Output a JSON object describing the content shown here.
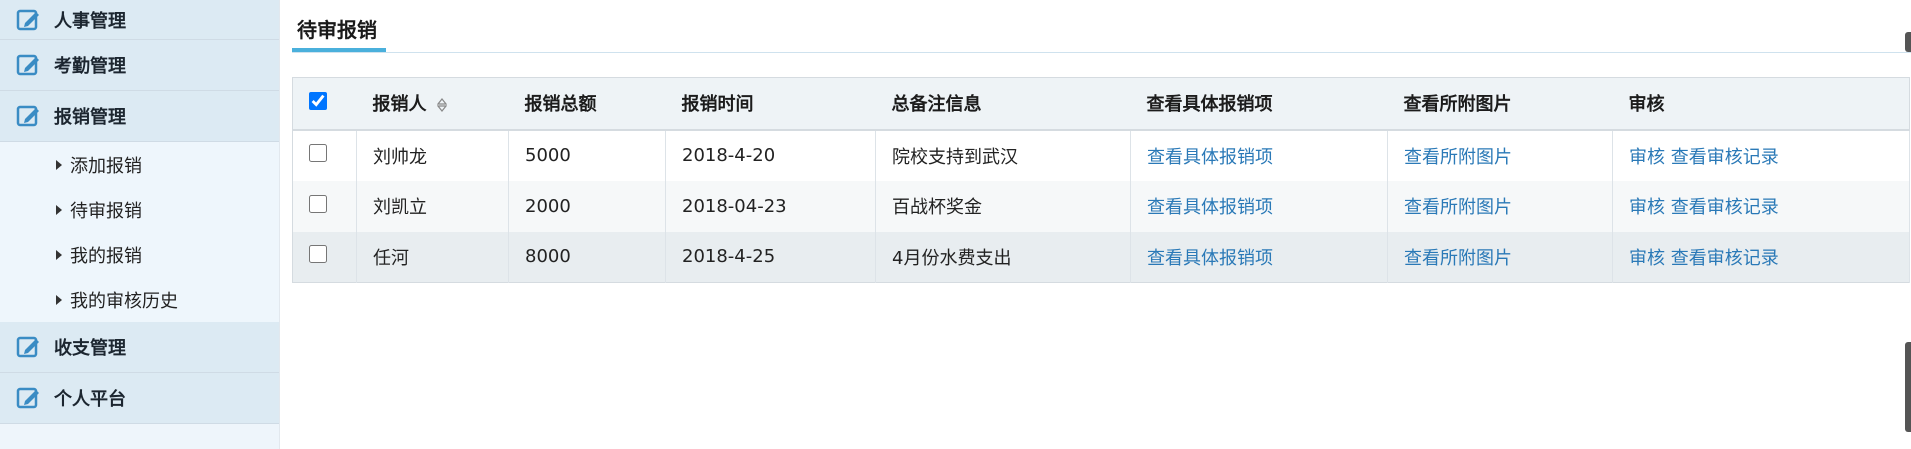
{
  "sidebar": {
    "groups": [
      {
        "label": "人事管理",
        "icon": "edit-icon"
      },
      {
        "label": "考勤管理",
        "icon": "edit-icon"
      },
      {
        "label": "报销管理",
        "icon": "edit-icon"
      },
      {
        "label": "收支管理",
        "icon": "edit-icon"
      },
      {
        "label": "个人平台",
        "icon": "edit-icon"
      }
    ],
    "sub_items": [
      {
        "label": "添加报销"
      },
      {
        "label": "待审报销"
      },
      {
        "label": "我的报销"
      },
      {
        "label": "我的审核历史"
      }
    ]
  },
  "main": {
    "tab_title": "待审报销",
    "accent_color": "#4ab0dc",
    "link_color": "#2a79b7",
    "table": {
      "headers": [
        "报销人",
        "报销总额",
        "报销时间",
        "总备注信息",
        "查看具体报销项",
        "查看所附图片",
        "审核"
      ],
      "select_all_checked": true,
      "rows": [
        {
          "name": "刘帅龙",
          "amount": "5000",
          "date": "2018-4-20",
          "note": "院校支持到武汉",
          "detail_link": "查看具体报销项",
          "image_link": "查看所附图片",
          "audit_link": "审核",
          "history_link": "查看审核记录"
        },
        {
          "name": "刘凯立",
          "amount": "2000",
          "date": "2018-04-23",
          "note": "百战杯奖金",
          "detail_link": "查看具体报销项",
          "image_link": "查看所附图片",
          "audit_link": "审核",
          "history_link": "查看审核记录"
        },
        {
          "name": "任河",
          "amount": "8000",
          "date": "2018-4-25",
          "note": "4月份水费支出",
          "detail_link": "查看具体报销项",
          "image_link": "查看所附图片",
          "audit_link": "审核",
          "history_link": "查看审核记录"
        }
      ]
    }
  }
}
